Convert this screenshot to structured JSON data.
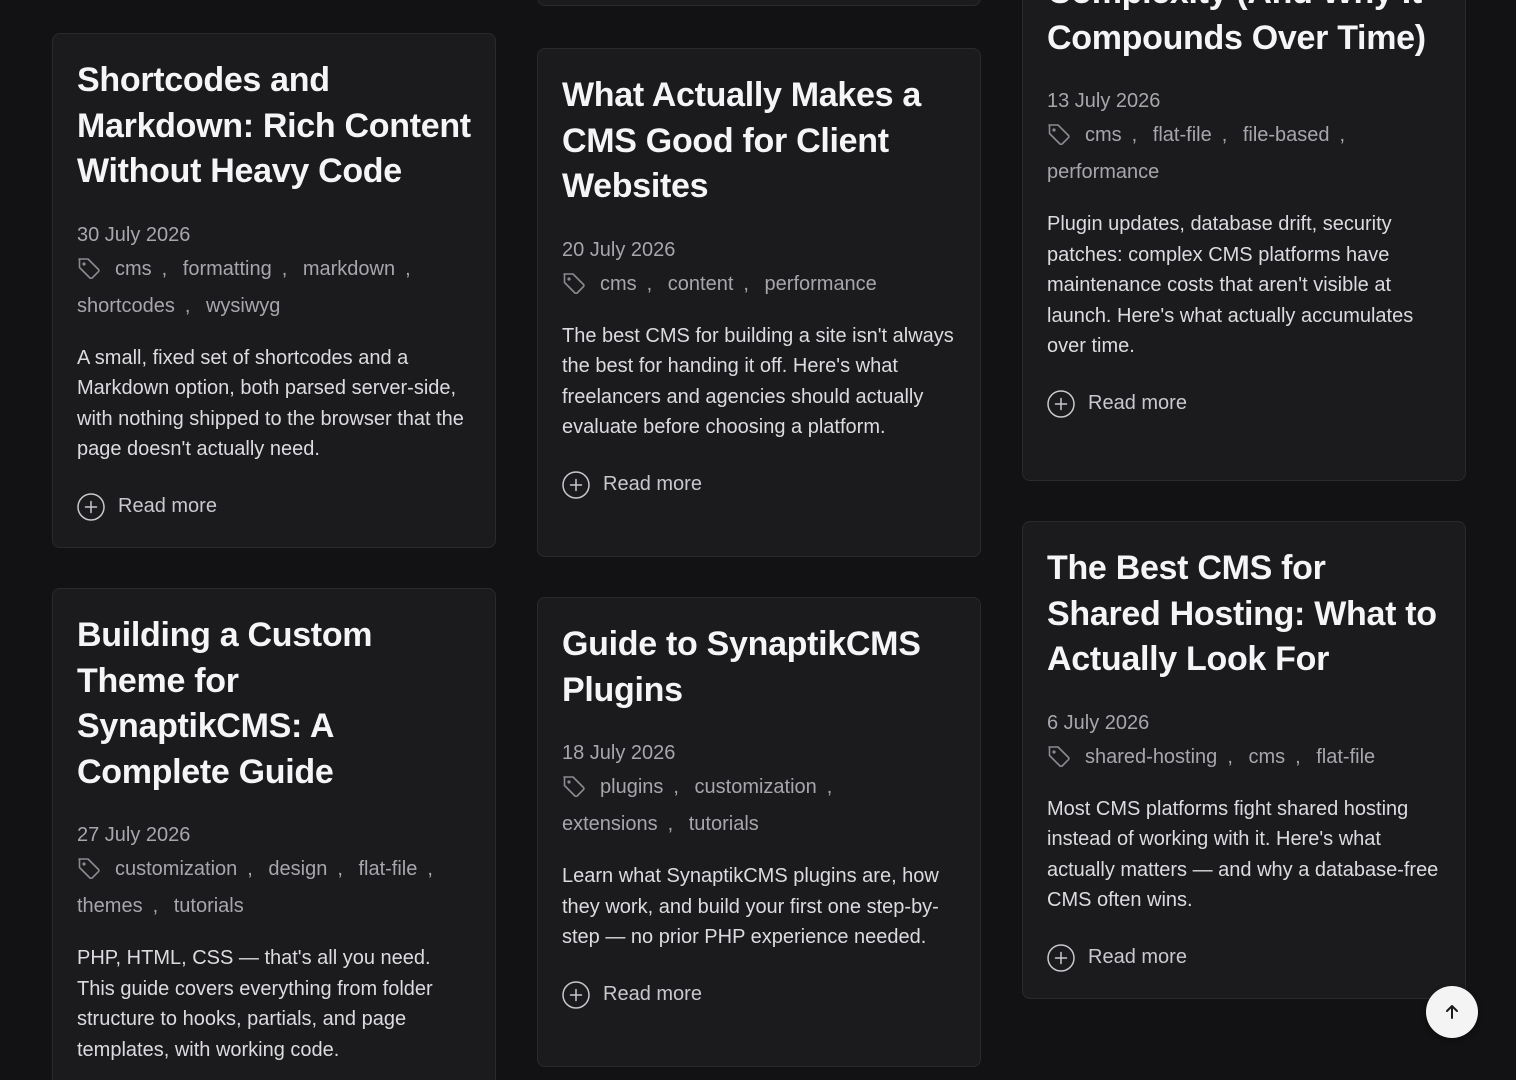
{
  "ui": {
    "read_more_label": "Read more",
    "separator": ","
  },
  "cards": [
    {
      "title": "Shortcodes and Markdown: Rich Content Without Heavy Code",
      "date": "30 July 2026",
      "tags": [
        "cms",
        "formatting",
        "markdown",
        "shortcodes",
        "wysiwyg"
      ],
      "excerpt": "A small, fixed set of shortcodes and a Markdown option, both parsed server-side, with nothing shipped to the browser that the page doesn't actually need."
    },
    {
      "title": "Building a Custom Theme for SynaptikCMS: A Complete Guide",
      "date": "27 July 2026",
      "tags": [
        "customization",
        "design",
        "flat-file",
        "themes",
        "tutorials"
      ],
      "excerpt": "PHP, HTML, CSS — that's all you need. This guide covers everything from folder structure to hooks, partials, and page templates, with working code."
    },
    {
      "title": "What Actually Makes a CMS Good for Client Websites",
      "date": "20 July 2026",
      "tags": [
        "cms",
        "content",
        "performance"
      ],
      "excerpt": "The best CMS for building a site isn't always the best for handing it off. Here's what freelancers and agencies should actually evaluate before choosing a platform."
    },
    {
      "title": "Guide to SynaptikCMS Plugins",
      "date": "18 July 2026",
      "tags": [
        "plugins",
        "customization",
        "extensions",
        "tutorials"
      ],
      "excerpt": "Learn what SynaptikCMS plugins are, how they work, and build your first one step-by-step — no prior PHP experience needed."
    },
    {
      "title": "Complexity (And Why It Compounds Over Time)",
      "date": "13 July 2026",
      "tags": [
        "cms",
        "flat-file",
        "file-based",
        "performance"
      ],
      "excerpt": "Plugin updates, database drift, security patches: complex CMS platforms have maintenance costs that aren't visible at launch. Here's what actually accumulates over time."
    },
    {
      "title": "The Best CMS for Shared Hosting: What to Actually Look For",
      "date": "6 July 2026",
      "tags": [
        "shared-hosting",
        "cms",
        "flat-file"
      ],
      "excerpt": "Most CMS platforms fight shared hosting instead of working with it. Here's what actually matters — and why a database-free CMS often wins."
    }
  ],
  "scroll_top": {
    "icon": "arrow-up-icon"
  },
  "colors": {
    "background": "#121214",
    "card": "#1b1b1e",
    "border": "#2a2a2e",
    "title": "#f5f5f7",
    "muted": "#a6a6ac"
  }
}
